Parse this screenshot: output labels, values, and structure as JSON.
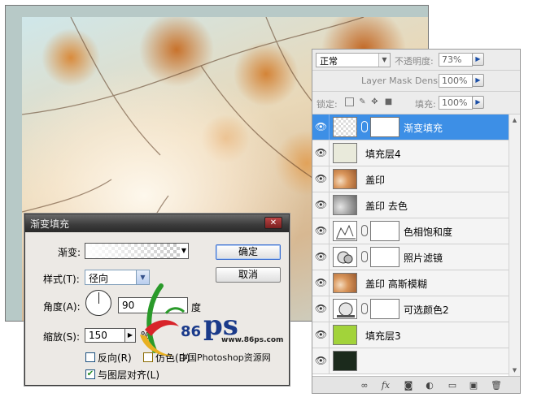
{
  "layers_panel": {
    "blend_mode": "正常",
    "opacity_label": "不透明度:",
    "opacity_value": "73%",
    "mask_density_label": "Layer Mask Density",
    "mask_density_value": "100%",
    "lock_label": "锁定:",
    "fill_label": "填充:",
    "fill_value": "100%",
    "layers": [
      {
        "name": "渐变填充",
        "thumb": "checker",
        "has_mask": true,
        "selected": true
      },
      {
        "name": "填充层4",
        "thumb": "cream",
        "has_mask": false,
        "selected": false
      },
      {
        "name": "盖印",
        "thumb": "photo",
        "has_mask": false,
        "selected": false
      },
      {
        "name": "盖印 去色",
        "thumb": "gray-photo",
        "has_mask": false,
        "selected": false
      },
      {
        "name": "色相饱和度",
        "thumb": "hue-saturation-adjustment",
        "has_mask": true,
        "selected": false
      },
      {
        "name": "照片滤镜",
        "thumb": "photo-filter-adjustment",
        "has_mask": true,
        "selected": false
      },
      {
        "name": "盖印 高斯模糊",
        "thumb": "photo",
        "has_mask": false,
        "selected": false
      },
      {
        "name": "可选颜色2",
        "thumb": "selective-color-adjustment",
        "has_mask": true,
        "selected": false
      },
      {
        "name": "填充层3",
        "thumb": "green",
        "has_mask": false,
        "selected": false
      }
    ]
  },
  "dialog": {
    "title": "渐变填充",
    "gradient_label": "渐变:",
    "style_label": "样式(T):",
    "style_value": "径向",
    "angle_label": "角度(A):",
    "angle_value": "90",
    "angle_unit": "度",
    "scale_label": "缩放(S):",
    "scale_value": "150",
    "scale_unit": "%",
    "reverse_label": "反向(R)",
    "reverse_checked": false,
    "dither_label": "仿色(D)",
    "dither_checked": false,
    "align_label": "与图层对齐(L)",
    "align_checked": true,
    "ok_label": "确定",
    "cancel_label": "取消"
  },
  "watermark": {
    "number": "86",
    "letters": "ps",
    "url": "www.86ps.com",
    "site_name": "中国Photoshop资源网"
  },
  "colors": {
    "selected_layer": "#3d8fe6",
    "fill_layer_green": "#a2d33a",
    "dialog_title_bg": "#3a3a3a"
  }
}
